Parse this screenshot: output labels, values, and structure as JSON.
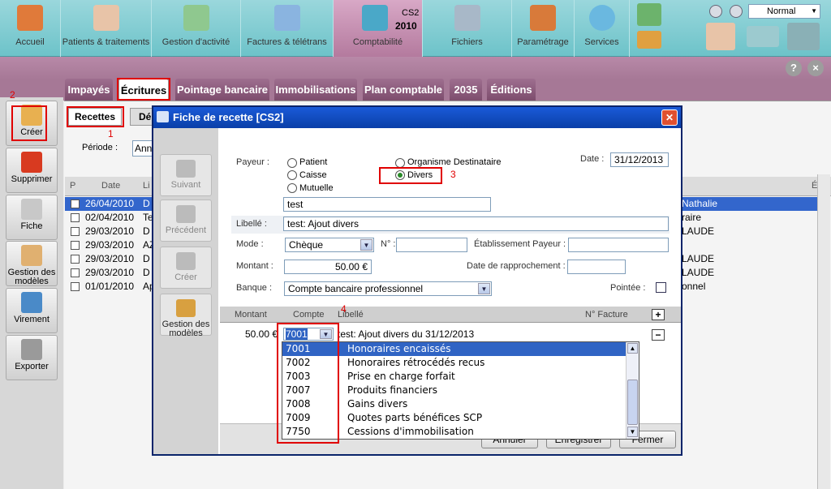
{
  "toolbar": {
    "items": [
      {
        "label": "Accueil",
        "icon": "house-icon"
      },
      {
        "label": "Patients & traitements",
        "icon": "doctor-icon"
      },
      {
        "label": "Gestion d'activité",
        "icon": "folder-icon"
      },
      {
        "label": "Factures & télétrans",
        "icon": "computer-icon"
      },
      {
        "label": "Comptabilité",
        "icon": "calculator-icon"
      },
      {
        "label": "Fichiers",
        "icon": "database-icon"
      },
      {
        "label": "Paramétrage",
        "icon": "gears-icon"
      },
      {
        "label": "Services",
        "icon": "globe-icon"
      }
    ],
    "accounting_tag1": "CS2",
    "accounting_tag2": "2010",
    "view_mode": "Normal"
  },
  "main_tabs": [
    "Impayés",
    "Écritures",
    "Pointage bancaire",
    "Immobilisations",
    "Plan comptable",
    "2035",
    "Éditions"
  ],
  "sub_tabs": [
    "Recettes",
    "Dé"
  ],
  "sidebar": {
    "buttons": [
      "Créer",
      "Supprimer",
      "Fiche",
      "Gestion des modèles",
      "Virement",
      "Exporter"
    ]
  },
  "annotations": {
    "n1": "1",
    "n2": "2",
    "n3": "3",
    "n4": "4"
  },
  "background": {
    "periode_label": "Période :",
    "periode_value": "Ann",
    "col_p": "P",
    "col_date": "Date",
    "col_li": "Li",
    "col_e": "É",
    "rows": [
      {
        "date": "26/04/2010",
        "c": "D",
        "name": "Nathalie"
      },
      {
        "date": "02/04/2010",
        "c": "Te",
        "name": "raire"
      },
      {
        "date": "29/03/2010",
        "c": "D",
        "name": "LAUDE"
      },
      {
        "date": "29/03/2010",
        "c": "AZ",
        "name": ""
      },
      {
        "date": "29/03/2010",
        "c": "D",
        "name": "LAUDE"
      },
      {
        "date": "29/03/2010",
        "c": "D",
        "name": "LAUDE"
      },
      {
        "date": "01/01/2010",
        "c": "Ap",
        "name": "onnel"
      }
    ]
  },
  "dialog": {
    "title": "Fiche de recette [CS2]",
    "left_buttons": [
      "Suivant",
      "Précédent",
      "Créer",
      "Gestion des modèles"
    ],
    "payeur_label": "Payeur :",
    "radios": [
      "Patient",
      "Caisse",
      "Mutuelle",
      "Organisme Destinataire",
      "Divers"
    ],
    "date_label": "Date :",
    "date_value": "31/12/2013",
    "payeur_name": "test",
    "libelle_label": "Libellé :",
    "libelle_value": "test: Ajout divers",
    "mode_label": "Mode :",
    "mode_value": "Chèque",
    "num_label": "N° :",
    "etab_label": "Établissement Payeur :",
    "montant_label": "Montant :",
    "montant_value": "50.00 €",
    "rappro_label": "Date de rapprochement :",
    "banque_label": "Banque :",
    "banque_value": "Compte bancaire professionnel",
    "pointee_label": "Pointée :",
    "grid_headers": [
      "Montant",
      "Compte",
      "Libellé",
      "N° Facture"
    ],
    "grid_row": {
      "montant": "50.00 €",
      "compte": "7001",
      "libelle": "test: Ajout divers du 31/12/2013"
    },
    "bottom_buttons": [
      "Annuler",
      "Enregistrer",
      "Fermer"
    ],
    "dropdown": [
      {
        "code": "7001",
        "text": "Honoraires encaissés"
      },
      {
        "code": "7002",
        "text": "Honoraires rétrocédés recus"
      },
      {
        "code": "7003",
        "text": "Prise en charge forfait"
      },
      {
        "code": "7007",
        "text": "Produits financiers"
      },
      {
        "code": "7008",
        "text": "Gains divers"
      },
      {
        "code": "7009",
        "text": "Quotes parts bénéfices SCP"
      },
      {
        "code": "7750",
        "text": "Cessions d'immobilisation"
      }
    ]
  }
}
